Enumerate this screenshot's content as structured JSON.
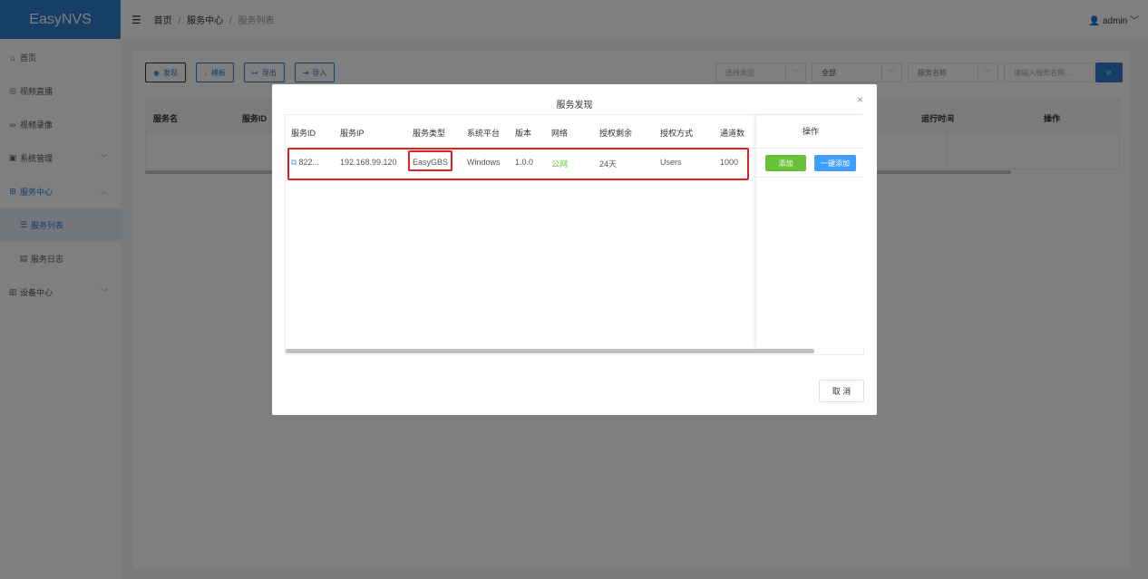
{
  "app": {
    "logo": "EasyNVS",
    "user": "admin"
  },
  "breadcrumb": {
    "home": "首页",
    "section": "服务中心",
    "current": "服务列表",
    "sep": "/"
  },
  "sidebar": {
    "items": [
      {
        "label": "首页",
        "icon": "home-icon"
      },
      {
        "label": "视频直播",
        "icon": "camera-icon"
      },
      {
        "label": "视频录像",
        "icon": "record-icon"
      },
      {
        "label": "系统管理",
        "icon": "settings-icon"
      },
      {
        "label": "服务中心",
        "icon": "grid-icon"
      },
      {
        "label": "服务列表",
        "icon": "list-icon"
      },
      {
        "label": "服务日志",
        "icon": "log-icon"
      },
      {
        "label": "设备中心",
        "icon": "device-icon"
      }
    ]
  },
  "toolbar": {
    "discover": "发现",
    "template": "模板",
    "export": "导出",
    "import": "导入"
  },
  "filters": {
    "type_placeholder": "选择类型",
    "all": "全部",
    "name_select": "服务名称",
    "search_placeholder": "请输入服务名称..."
  },
  "bg_table": {
    "col_name": "服务名",
    "col_id": "服务ID",
    "col_runtime": "运行时间",
    "col_op": "操作"
  },
  "modal": {
    "title": "服务发现",
    "close": "×",
    "cancel": "取 消",
    "columns": {
      "id": "服务ID",
      "ip": "服务IP",
      "type": "服务类型",
      "platform": "系统平台",
      "version": "版本",
      "network": "网络",
      "remaining": "授权剩余",
      "auth_mode": "授权方式",
      "channels": "通道数",
      "op": "操作"
    },
    "row": {
      "id": "822...",
      "ip": "192.168.99.120",
      "type": "EasyGBS",
      "platform": "Windows",
      "version": "1.0.0",
      "network": "公网",
      "remaining": "24天",
      "auth_mode": "Users",
      "channels": "1000"
    },
    "actions": {
      "add": "添加",
      "add_one_click": "一键添加"
    }
  },
  "colors": {
    "primary": "#2f7dcf",
    "success": "#67c23a",
    "info": "#409eff",
    "highlight": "#e02020"
  }
}
